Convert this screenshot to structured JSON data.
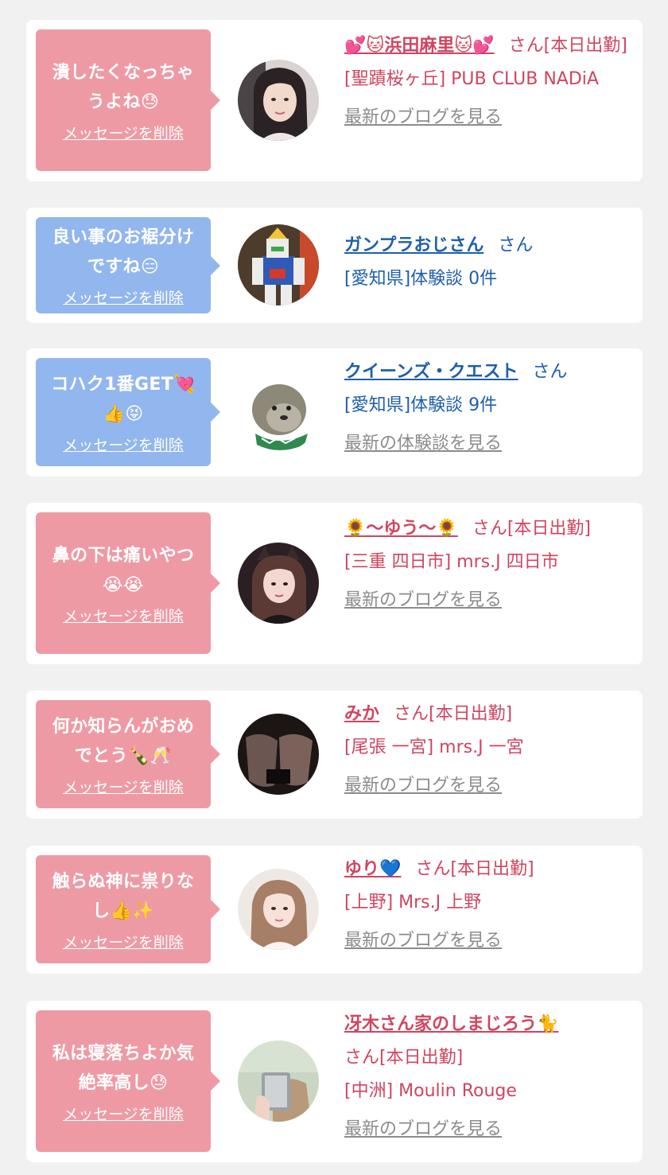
{
  "messages": [
    {
      "bubble_text": "潰したくなっちゃうよね😓",
      "delete_label": "メッセージを削除",
      "name_prefix": "💕🐱",
      "name": "浜田麻里",
      "name_suffix": "🐱💕",
      "honorific": "さん[本日出勤]",
      "location": "[聖蹟桜ヶ丘] PUB CLUB NADiA",
      "link_label": "最新のブログを見る",
      "theme": "pink",
      "avatar_icon": "woman-photo"
    },
    {
      "bubble_text": "良い事のお裾分けですね😑",
      "delete_label": "メッセージを削除",
      "name_prefix": "",
      "name": "ガンプラおじさん",
      "name_suffix": "",
      "honorific": "さん",
      "location": "[愛知県]体験談 0件",
      "link_label": "",
      "theme": "blue",
      "avatar_icon": "gundam-photo"
    },
    {
      "bubble_text": "コハク1番GET💘👍😝",
      "delete_label": "メッセージを削除",
      "name_prefix": "",
      "name": "クイーンズ・クエスト",
      "name_suffix": "",
      "honorific": "さん",
      "location": "[愛知県]体験談 9件",
      "link_label": "最新の体験談を見る",
      "theme": "blue",
      "avatar_icon": "otter-character"
    },
    {
      "bubble_text": "鼻の下は痛いやつ😭😭",
      "delete_label": "メッセージを削除",
      "name_prefix": "🌻",
      "name": "〜ゆう〜",
      "name_suffix": "🌻",
      "honorific": "さん[本日出勤]",
      "location": "[三重 四日市] mrs.J 四日市",
      "link_label": "最新のブログを見る",
      "theme": "pink",
      "avatar_icon": "woman-photo"
    },
    {
      "bubble_text": "何か知らんがおめでとう🍾🥂",
      "delete_label": "メッセージを削除",
      "name_prefix": "",
      "name": "みか",
      "name_suffix": "",
      "honorific": "さん[本日出勤]",
      "location": "[尾張 一宮] mrs.J 一宮",
      "link_label": "最新のブログを見る",
      "theme": "pink",
      "avatar_icon": "legs-photo"
    },
    {
      "bubble_text": "触らぬ神に祟りなし👍✨",
      "delete_label": "メッセージを削除",
      "name_prefix": "",
      "name": "ゆり💙",
      "name_suffix": "",
      "honorific": "さん[本日出勤]",
      "location": "[上野] Mrs.J 上野",
      "link_label": "最新のブログを見る",
      "theme": "pink",
      "avatar_icon": "woman-photo"
    },
    {
      "bubble_text": "私は寝落ちよか気絶率高し😓",
      "delete_label": "メッセージを削除",
      "name_prefix": "",
      "name": "冴木さん家のしまじろう🐈",
      "name_suffix": "",
      "honorific": "さん[本日出勤]",
      "location": "[中洲] Moulin Rouge",
      "link_label": "最新のブログを見る",
      "theme": "pink",
      "avatar_icon": "selfie-photo"
    }
  ],
  "colors": {
    "pink_bubble": "#ee9aa5",
    "blue_bubble": "#92b6ee",
    "pink_text": "#d0455f",
    "blue_text": "#1f5fa8",
    "link_gray": "#8c8c8c",
    "background": "#f1f1f1"
  }
}
